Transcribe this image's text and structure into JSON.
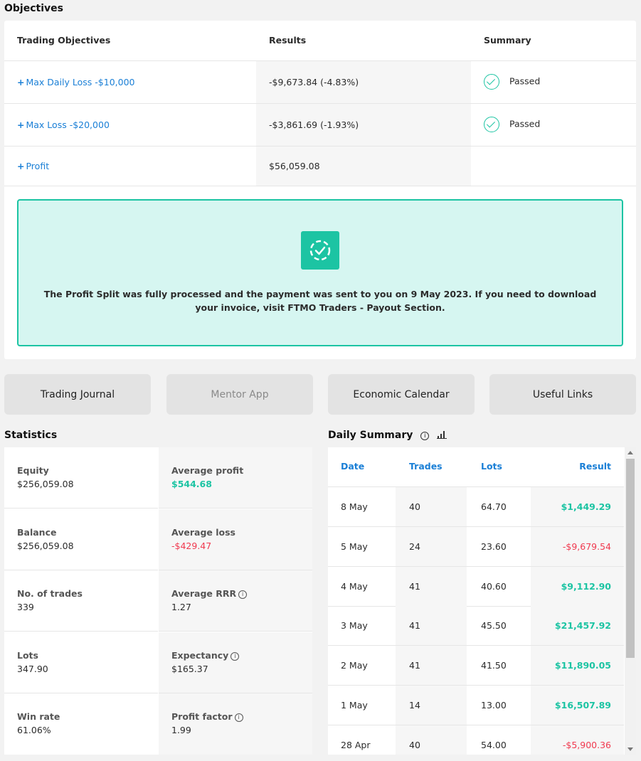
{
  "objectives": {
    "title": "Objectives",
    "headers": [
      "Trading Objectives",
      "Results",
      "Summary"
    ],
    "rows": [
      {
        "label": "Max Daily Loss -$10,000",
        "result": "-$9,673.84 (-4.83%)",
        "summary": "Passed"
      },
      {
        "label": "Max Loss -$20,000",
        "result": "-$3,861.69 (-1.93%)",
        "summary": "Passed"
      },
      {
        "label": "Profit",
        "result": "$56,059.08",
        "summary": ""
      }
    ],
    "notice_text": "The Profit Split was fully processed and the payment was sent to you on 9 May 2023. If you need to download your invoice, visit FTMO Traders - Payout Section."
  },
  "nav": {
    "trading_journal": "Trading Journal",
    "mentor_app": "Mentor App",
    "economic_calendar": "Economic Calendar",
    "useful_links": "Useful Links"
  },
  "statistics": {
    "title": "Statistics",
    "items": [
      {
        "label": "Equity",
        "value": "$256,059.08"
      },
      {
        "label": "Average profit",
        "value": "$544.68"
      },
      {
        "label": "Balance",
        "value": "$256,059.08"
      },
      {
        "label": "Average loss",
        "value": "-$429.47"
      },
      {
        "label": "No. of trades",
        "value": "339"
      },
      {
        "label": "Average RRR",
        "value": "1.27"
      },
      {
        "label": "Lots",
        "value": "347.90"
      },
      {
        "label": "Expectancy",
        "value": "$165.37"
      },
      {
        "label": "Win rate",
        "value": "61.06%"
      },
      {
        "label": "Profit factor",
        "value": "1.99"
      }
    ]
  },
  "daily_summary": {
    "title": "Daily Summary",
    "headers": [
      "Date",
      "Trades",
      "Lots",
      "Result"
    ],
    "rows": [
      {
        "date": "8 May",
        "trades": "40",
        "lots": "64.70",
        "result": "$1,449.29"
      },
      {
        "date": "5 May",
        "trades": "24",
        "lots": "23.60",
        "result": "-$9,679.54"
      },
      {
        "date": "4 May",
        "trades": "41",
        "lots": "40.60",
        "result": "$9,112.90"
      },
      {
        "date": "3 May",
        "trades": "41",
        "lots": "45.50",
        "result": "$21,457.92"
      },
      {
        "date": "2 May",
        "trades": "41",
        "lots": "41.50",
        "result": "$11,890.05"
      },
      {
        "date": "1 May",
        "trades": "14",
        "lots": "13.00",
        "result": "$16,507.89"
      },
      {
        "date": "28 Apr",
        "trades": "40",
        "lots": "54.00",
        "result": "-$5,900.36"
      }
    ]
  },
  "colors": {
    "accent": "#1cc4a3",
    "link": "#1a7fd6",
    "negative": "#f0394f"
  },
  "icons": [
    "check-circle-icon",
    "dashed-check-icon",
    "info-icon",
    "bar-chart-icon",
    "plus-icon"
  ]
}
